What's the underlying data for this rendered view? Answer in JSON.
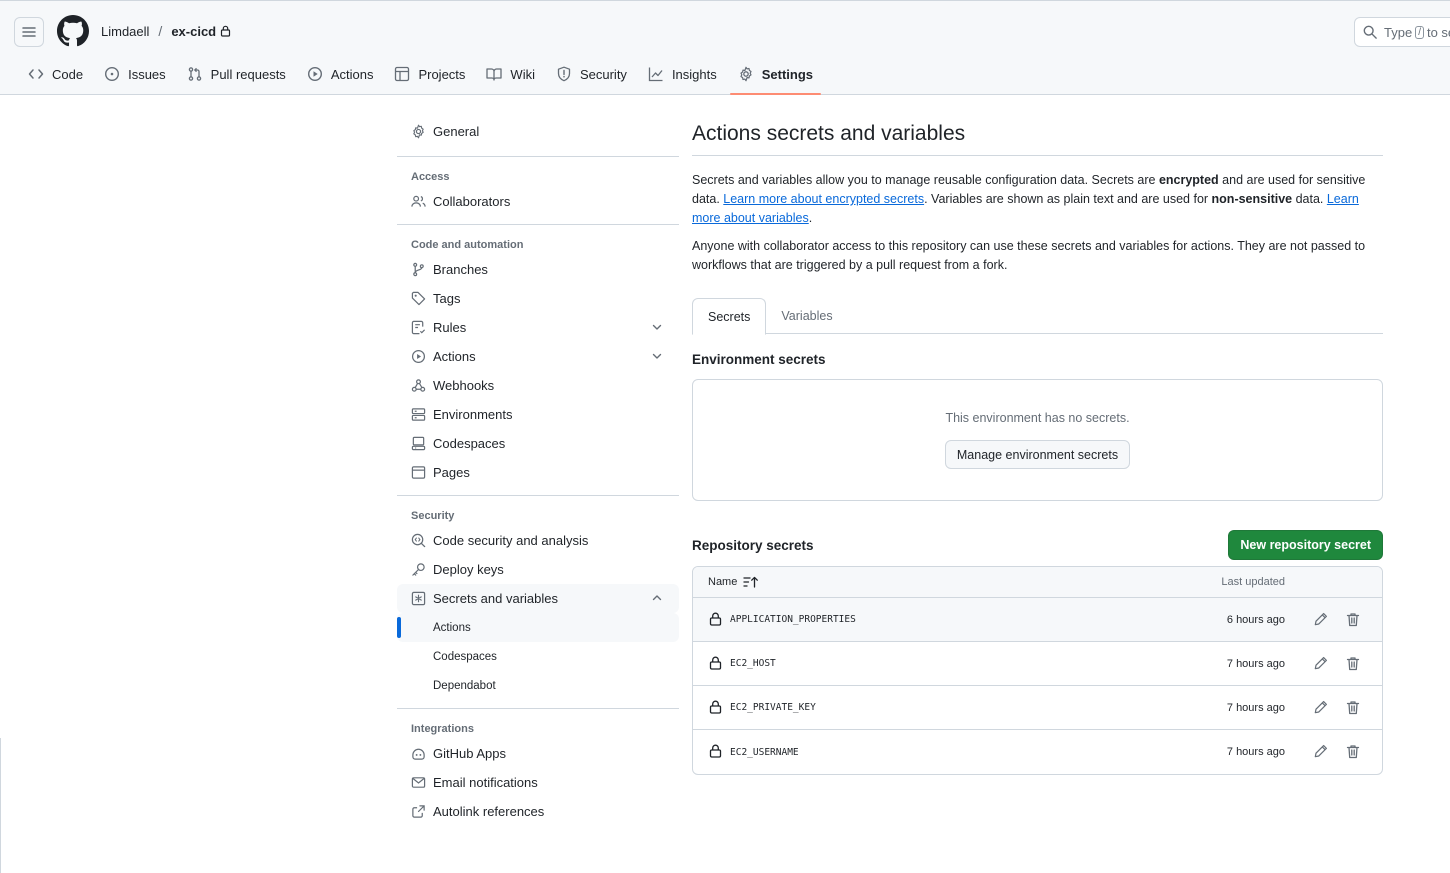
{
  "header": {
    "owner": "Limdaell",
    "separator": "/",
    "repo": "ex-cicd",
    "search_prefix": "Type",
    "search_key": "/",
    "search_suffix": "to se"
  },
  "nav": [
    {
      "label": "Code",
      "icon": "code-icon"
    },
    {
      "label": "Issues",
      "icon": "issue-icon"
    },
    {
      "label": "Pull requests",
      "icon": "pull-request-icon"
    },
    {
      "label": "Actions",
      "icon": "play-icon"
    },
    {
      "label": "Projects",
      "icon": "table-icon"
    },
    {
      "label": "Wiki",
      "icon": "book-icon"
    },
    {
      "label": "Security",
      "icon": "shield-icon"
    },
    {
      "label": "Insights",
      "icon": "graph-icon"
    },
    {
      "label": "Settings",
      "icon": "gear-icon",
      "active": true
    }
  ],
  "sidebar": {
    "general": "General",
    "access_heading": "Access",
    "collaborators": "Collaborators",
    "code_heading": "Code and automation",
    "branches": "Branches",
    "tags": "Tags",
    "rules": "Rules",
    "actions": "Actions",
    "webhooks": "Webhooks",
    "environments": "Environments",
    "codespaces": "Codespaces",
    "pages": "Pages",
    "security_heading": "Security",
    "code_security": "Code security and analysis",
    "deploy_keys": "Deploy keys",
    "secrets_vars": "Secrets and variables",
    "sub_actions": "Actions",
    "sub_codespaces": "Codespaces",
    "sub_dependabot": "Dependabot",
    "integrations_heading": "Integrations",
    "github_apps": "GitHub Apps",
    "email_notifications": "Email notifications",
    "autolink": "Autolink references"
  },
  "main": {
    "title": "Actions secrets and variables",
    "p1_a": "Secrets and variables allow you to manage reusable configuration data. Secrets are ",
    "p1_b": "encrypted",
    "p1_c": " and are used for sensitive data. ",
    "p1_link1": "Learn more about encrypted secrets",
    "p1_d": ". Variables are shown as plain text and are used for ",
    "p1_e": "non-sensitive",
    "p1_f": " data. ",
    "p1_link2": "Learn more about variables",
    "p1_g": ".",
    "p2": "Anyone with collaborator access to this repository can use these secrets and variables for actions. They are not passed to workflows that are triggered by a pull request from a fork.",
    "tab_secrets": "Secrets",
    "tab_variables": "Variables",
    "env_title": "Environment secrets",
    "env_empty": "This environment has no secrets.",
    "env_button": "Manage environment secrets",
    "repo_title": "Repository secrets",
    "new_button": "New repository secret",
    "col_name": "Name",
    "col_updated": "Last updated",
    "secrets": [
      {
        "name": "APPLICATION_PROPERTIES",
        "updated": "6 hours ago"
      },
      {
        "name": "EC2_HOST",
        "updated": "7 hours ago"
      },
      {
        "name": "EC2_PRIVATE_KEY",
        "updated": "7 hours ago"
      },
      {
        "name": "EC2_USERNAME",
        "updated": "7 hours ago"
      }
    ]
  },
  "colors": {
    "accent": "#0969da",
    "tab_underline": "#fd8c73",
    "primary_button": "#1f883d",
    "border": "#d0d7de"
  }
}
